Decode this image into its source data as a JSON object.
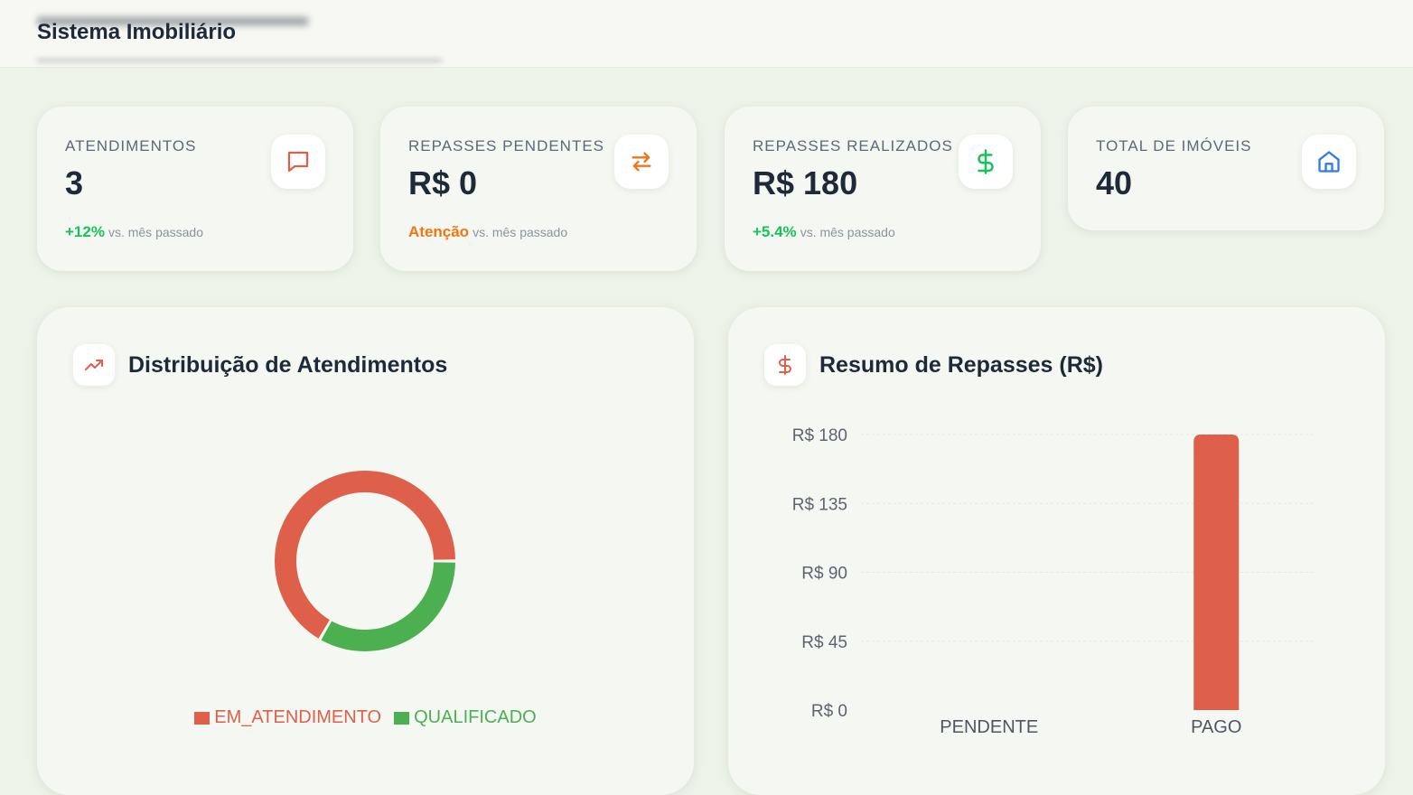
{
  "header": {
    "title": "Sistema Imobiliário"
  },
  "colors": {
    "accent": "#df604a",
    "green": "#4caf50",
    "positive": "#16c35a",
    "warning": "#f27512",
    "blue": "#2f7de0"
  },
  "stats": [
    {
      "label": "ATENDIMENTOS",
      "value": "3",
      "delta": "+12%",
      "foot": "vs. mês passado",
      "icon": "chat-icon"
    },
    {
      "label": "REPASSES PENDENTES",
      "value": "R$ 0",
      "delta": "Atenção",
      "foot": "vs. mês passado",
      "icon": "transfer-arrows-icon"
    },
    {
      "label": "REPASSES REALIZADOS",
      "value": "R$ 180",
      "delta": "+5.4%",
      "foot": "vs. mês passado",
      "icon": "dollar-icon"
    },
    {
      "label": "TOTAL DE IMÓVEIS",
      "value": "40",
      "icon": "home-icon"
    }
  ],
  "panels": {
    "distribution": {
      "title": "Distribuição de Atendimentos",
      "icon": "trending-up-icon"
    },
    "repasses": {
      "title": "Resumo de Repasses (R$)",
      "icon": "dollar-icon"
    }
  },
  "chart_data": [
    {
      "type": "pie",
      "categories": [
        "EM_ATENDIMENTO",
        "QUALIFICADO"
      ],
      "values": [
        2,
        1
      ],
      "colors": [
        "#df604a",
        "#4caf50"
      ],
      "legend": "bottom"
    },
    {
      "type": "bar",
      "categories": [
        "PENDENTE",
        "PAGO"
      ],
      "values": [
        0,
        180
      ],
      "ylim": [
        0,
        180
      ],
      "yticks": [
        0,
        45,
        90,
        135,
        180
      ],
      "ytick_labels": [
        "R$ 0",
        "R$ 45",
        "R$ 90",
        "R$ 135",
        "R$ 180"
      ],
      "color": "#df604a",
      "grid": true
    }
  ]
}
